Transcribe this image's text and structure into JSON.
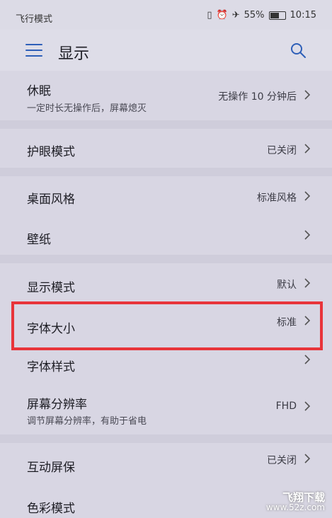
{
  "status_bar": {
    "left_text": "飞行模式",
    "battery": "55%",
    "time": "10:15"
  },
  "app_bar": {
    "title": "显示",
    "menu_icon": "menu-icon",
    "search_icon": "search-icon"
  },
  "settings": [
    {
      "title": "休眠",
      "subtitle": "一定时长无操作后，屏幕熄灭",
      "value": "无操作 10 分钟后"
    },
    {
      "title": "护眼模式",
      "subtitle": "",
      "value": "已关闭"
    },
    {
      "title": "桌面风格",
      "subtitle": "",
      "value": "标准风格"
    },
    {
      "title": "壁纸",
      "subtitle": "",
      "value": ""
    },
    {
      "title": "显示模式",
      "subtitle": "",
      "value": "默认"
    },
    {
      "title": "字体大小",
      "subtitle": "",
      "value": "标准"
    },
    {
      "title": "字体样式",
      "subtitle": "",
      "value": ""
    },
    {
      "title": "屏幕分辨率",
      "subtitle": "调节屏幕分辨率，有助于省电",
      "value": "FHD"
    },
    {
      "title": "互动屏保",
      "subtitle": "",
      "value": "已关闭"
    },
    {
      "title": "色彩模式",
      "subtitle": "",
      "value": ""
    }
  ],
  "watermark": {
    "brand": "飞翔下载",
    "url": "www.52z.com"
  },
  "colors": {
    "accent": "#2e5fb8",
    "highlight_border": "#e8343a"
  }
}
